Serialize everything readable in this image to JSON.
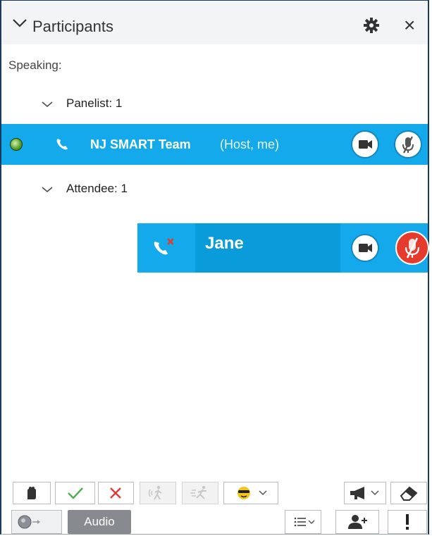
{
  "header": {
    "title": "Participants"
  },
  "speaking_label": "Speaking:",
  "groups": [
    {
      "label": "Panelist: 1"
    },
    {
      "label": "Attendee: 1"
    }
  ],
  "participants": [
    {
      "name": "NJ SMART Team",
      "role": "(Host, me)",
      "status": "online",
      "muted": false,
      "audio_disconnected": false
    },
    {
      "name": "Jane",
      "role": "",
      "muted": true,
      "audio_disconnected": true
    }
  ],
  "toolbar": {
    "audio_label": "Audio"
  },
  "icons": {
    "header": [
      "chevron-down-icon",
      "gear-icon",
      "close-icon"
    ],
    "participant_row": [
      "status-dot-icon",
      "phone-icon",
      "video-icon",
      "mic-muted-icon"
    ],
    "jane_row": [
      "phone-disconnected-icon",
      "video-icon",
      "mic-muted-icon"
    ],
    "toolbar_row1": [
      "raise-hand-icon",
      "check-icon",
      "x-icon",
      "slower-icon",
      "faster-icon",
      "emoji-icon",
      "megaphone-icon",
      "eraser-icon"
    ],
    "toolbar_row2": [
      "status-toggle-icon",
      "list-icon",
      "add-user-icon",
      "exclamation-icon"
    ]
  },
  "colors": {
    "row_highlight": "#14a9ea",
    "muted_red": "#e53b2c",
    "check_green": "#4caf50",
    "x_red": "#e53935"
  }
}
